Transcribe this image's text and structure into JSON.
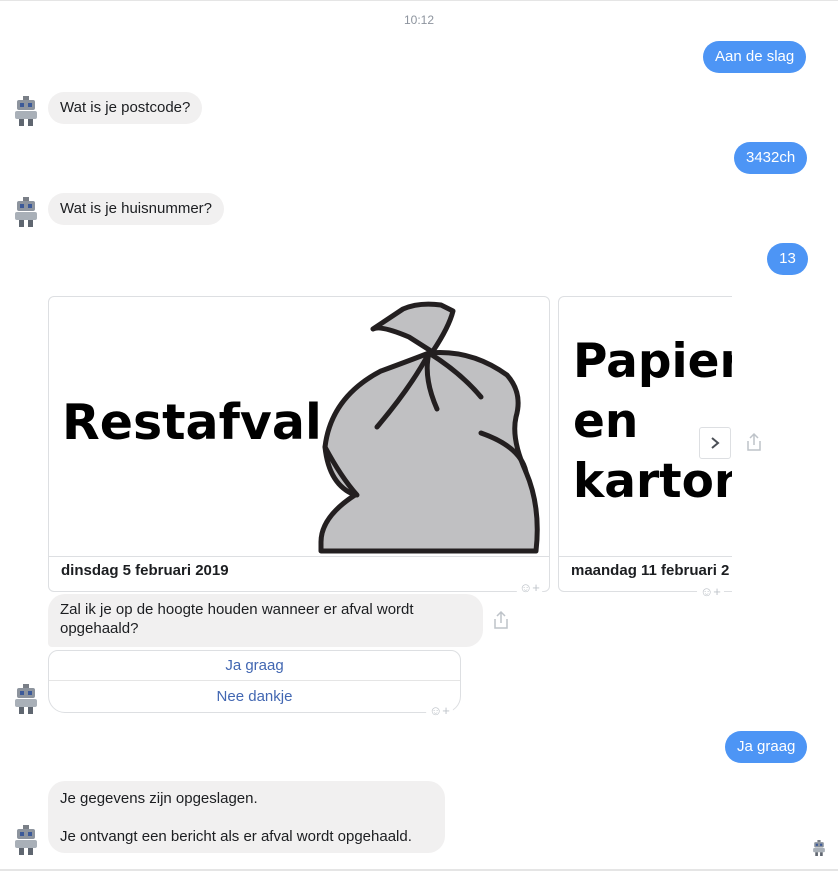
{
  "timestamp": "10:12",
  "messages": {
    "m1": "Aan de slag",
    "m2": "Wat is je postcode?",
    "m3": "3432ch",
    "m4": "Wat is je huisnummer?",
    "m5": "13",
    "m6": "Zal ik je op de hoogte houden wanneer er afval wordt opgehaald?",
    "m7": "Ja graag",
    "m8_line1": "Je gegevens zijn opgeslagen.",
    "m8_line2": "Je ontvangt een bericht als er afval wordt opgehaald."
  },
  "cards": [
    {
      "title": "Restafval",
      "date": "dinsdag 5 februari 2019"
    },
    {
      "title_lines": [
        "Papier",
        "en",
        "karton"
      ],
      "date": "maandag 11 februari 2"
    }
  ],
  "quick_replies": {
    "yes": "Ja graag",
    "no": "Nee dankje"
  },
  "icons": {
    "avatar": "robot-avatar-icon",
    "next": "chevron-right-icon",
    "share": "share-icon",
    "react": "add-reaction-icon"
  },
  "colors": {
    "outgoing_bubble": "#4d95f5",
    "incoming_bubble": "#f1f0f0",
    "quick_reply_text": "#4267b2",
    "bag_fill": "#c0c0c2"
  }
}
